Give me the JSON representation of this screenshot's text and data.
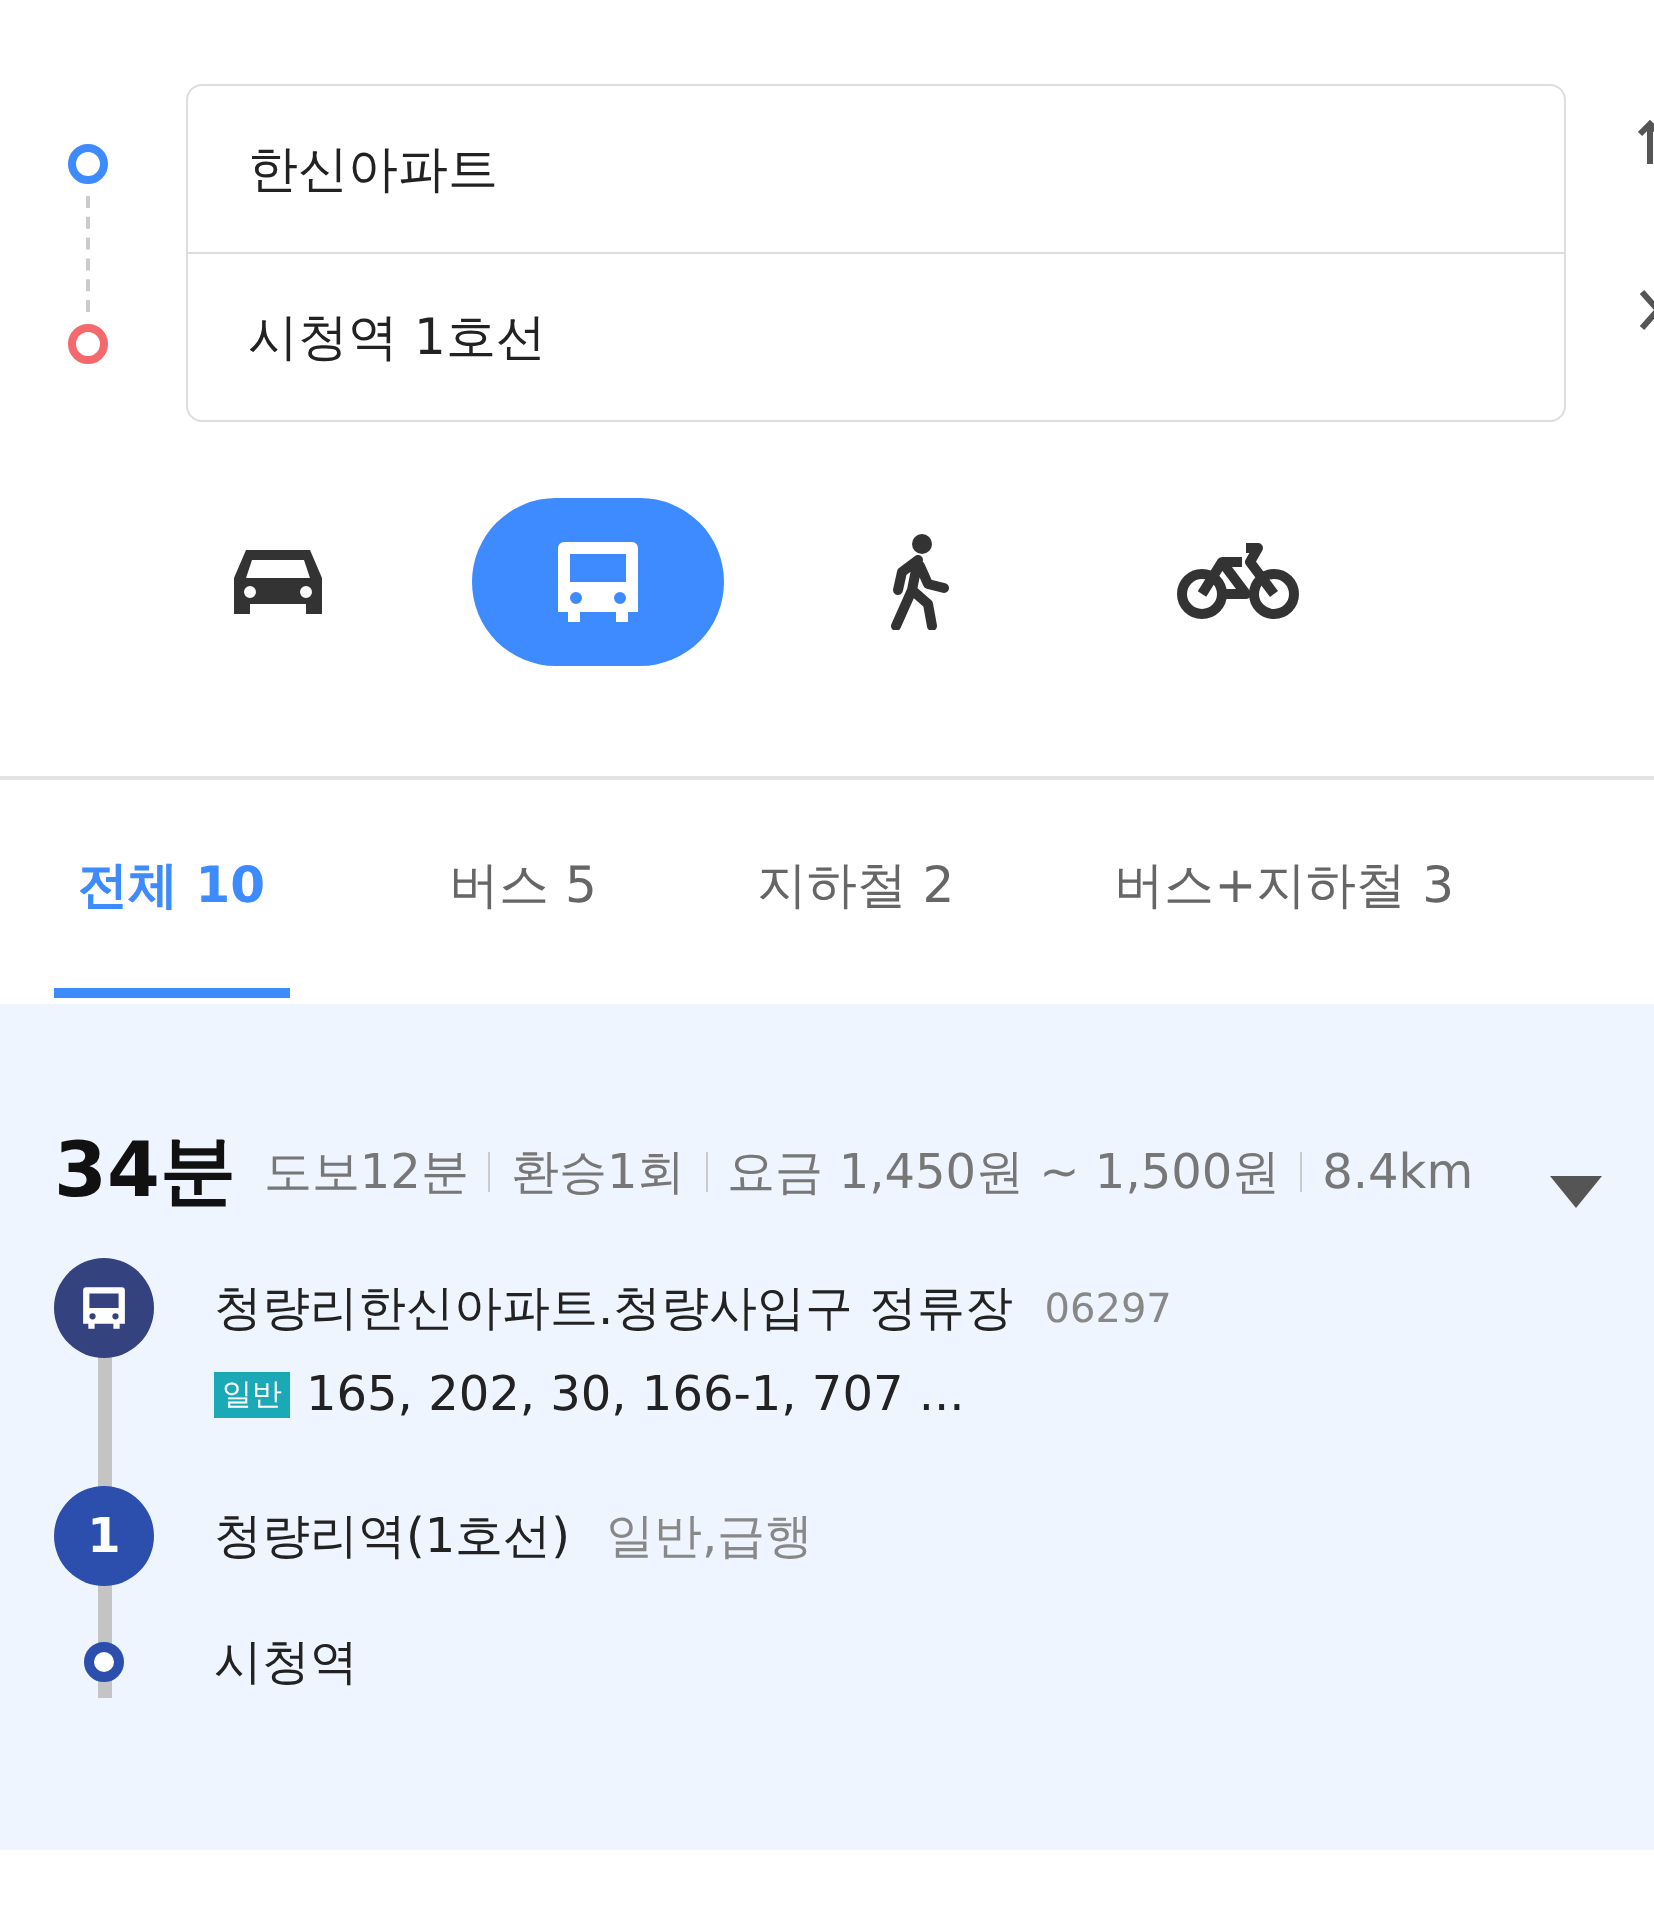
{
  "route_inputs": {
    "origin": "한신아파트",
    "destination": "시청역 1호선"
  },
  "modes": [
    {
      "kind": "car",
      "selected": false
    },
    {
      "kind": "bus",
      "selected": true
    },
    {
      "kind": "walk",
      "selected": false
    },
    {
      "kind": "bike",
      "selected": false
    }
  ],
  "tabs": [
    {
      "label": "전체 10",
      "selected": true
    },
    {
      "label": "버스 5",
      "selected": false
    },
    {
      "label": "지하철 2",
      "selected": false
    },
    {
      "label": "버스+지하철 3",
      "selected": false
    }
  ],
  "result": {
    "duration": "34분",
    "details": [
      "도보12분",
      "환승1회",
      "요금 1,450원 ~ 1,500원",
      "8.4km"
    ],
    "steps": [
      {
        "kind": "bus",
        "name": "청량리한신아파트.청량사입구 정류장",
        "code": "06297",
        "badge": "일반",
        "lines": "165, 202, 30, 166-1, 707 ..."
      },
      {
        "kind": "subway",
        "marker": "1",
        "name": "청량리역(1호선)",
        "note": "일반,급행"
      },
      {
        "kind": "end",
        "name": "시청역"
      }
    ]
  }
}
